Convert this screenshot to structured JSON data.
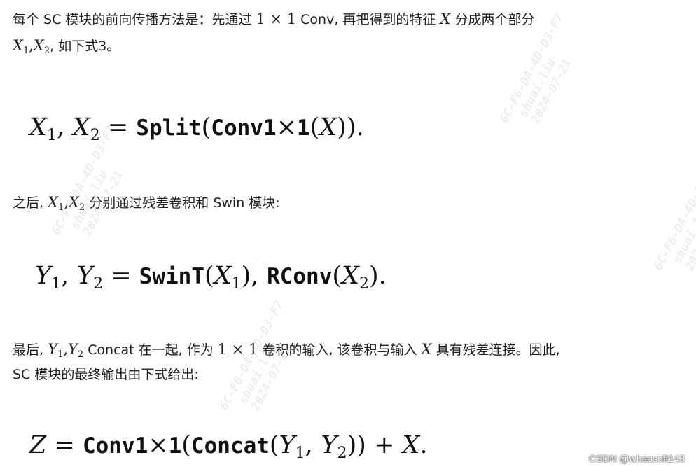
{
  "para1": {
    "line1_a": "每个 SC 模块的前向传播方法是：先通过 ",
    "line1_math_conv": "1 × 1",
    "line1_b": " Conv, 再把得到的特征 ",
    "line1_x": "X",
    "line1_c": " 分成两个部分",
    "line2_x1": "X",
    "line2_sub1": "1",
    "line2_x2": "X",
    "line2_sub2": "2",
    "line2_tail": ", 如下式3。"
  },
  "eq1": {
    "x1": "X",
    "s1": "1",
    "comma": ",",
    "x2": "X",
    "s2": "2",
    "eq": "=",
    "split": "Split",
    "lp1": "(",
    "conv": "Conv1",
    "times": "×",
    "one": "1",
    "lp2": "(",
    "x": "X",
    "rp2": "))."
  },
  "para2": {
    "a": "之后, ",
    "x1": "X",
    "s1": "1",
    "x2": "X",
    "s2": "2",
    "b": " 分别通过残差卷积和 Swin 模块:"
  },
  "eq2": {
    "y1": "Y",
    "s1": "1",
    "comma": ",",
    "y2": "Y",
    "s2": "2",
    "eq": "=",
    "swin": "SwinT",
    "lp1": "(",
    "x1": "X",
    "xs1": "1",
    "rp1": "),",
    "rconv": "RConv",
    "lp2": "(",
    "x2": "X",
    "xs2": "2",
    "rp2": ")."
  },
  "para3": {
    "a": "最后, ",
    "y1": "Y",
    "s1": "1",
    "y2": "Y",
    "s2": "2",
    "b": " Concat 在一起, 作为 ",
    "conv": "1 × 1",
    "c": " 卷积的输入, 该卷积与输入 ",
    "x": "X",
    "d": " 具有残差连接。因此,",
    "line2": "SC 模块的最终输出由下式给出:"
  },
  "eq3": {
    "z": "Z",
    "eq": "=",
    "conv": "Conv1",
    "times": "×",
    "one": "1",
    "lp1": "(",
    "concat": "Concat",
    "lp2": "(",
    "y1": "Y",
    "s1": "1",
    "comma": ",",
    "y2": "Y",
    "s2": "2",
    "rp": "))",
    "plus": "+",
    "x": "X",
    "dot": "."
  },
  "watermark": {
    "text": "6C-F6-DA-4D-D3-F7\n  shuai.liu\n  2024-07-21"
  },
  "footer": {
    "credit": "CSDN @whaosoft143"
  }
}
